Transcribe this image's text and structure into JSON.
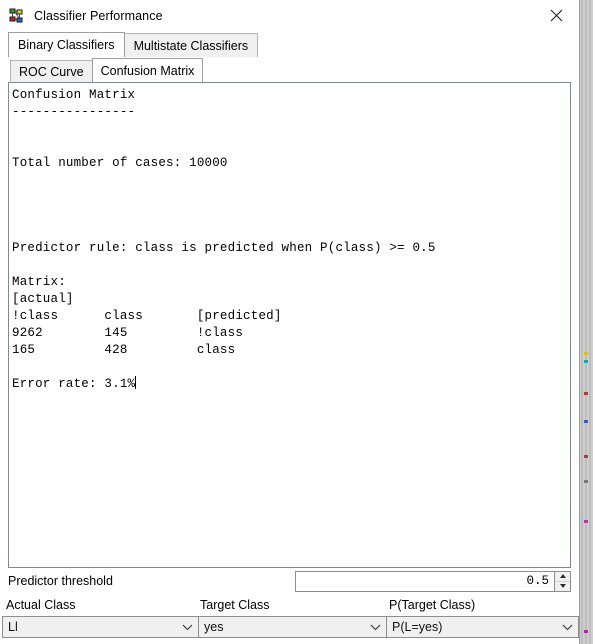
{
  "window": {
    "title": "Classifier Performance",
    "icon": "classifier-network-icon",
    "close_label": "×"
  },
  "outer_tabs": [
    {
      "label": "Binary Classifiers",
      "active": true
    },
    {
      "label": "Multistate Classifiers",
      "active": false
    }
  ],
  "inner_tabs": [
    {
      "label": "ROC Curve",
      "active": false
    },
    {
      "label": "Confusion Matrix",
      "active": true
    }
  ],
  "report": {
    "heading": "Confusion Matrix",
    "underline": "----------------",
    "total_cases_line": "Total number of cases: 10000",
    "predictor_rule_line": "Predictor rule: class is predicted when P(class) >= 0.5",
    "matrix_label": "Matrix:",
    "actual_label": "[actual]",
    "matrix_header": "!class      class       [predicted]",
    "matrix_row_1": "9262        145         !class",
    "matrix_row_2": "165         428         class",
    "error_rate_line": "Error rate: 3.1%",
    "full_text": "Confusion Matrix\n----------------\n\n\nTotal number of cases: 10000\n\n\n\n\nPredictor rule: class is predicted when P(class) >= 0.5\n\nMatrix:\n[actual]\n!class      class       [predicted]\n9262        145         !class\n165         428         class\n\nError rate: 3.1%"
  },
  "matrix_data": {
    "total_cases": 10000,
    "threshold": 0.5,
    "error_rate_percent": 3.1,
    "columns": [
      "!class",
      "class"
    ],
    "row_header": "[predicted]",
    "rows": [
      {
        "predicted": "!class",
        "counts": [
          9262,
          145
        ]
      },
      {
        "predicted": "class",
        "counts": [
          165,
          428
        ]
      }
    ]
  },
  "threshold": {
    "label": "Predictor threshold",
    "value": "0.5",
    "increment_icon": "spinner-up-icon",
    "decrement_icon": "spinner-down-icon"
  },
  "selectors": [
    {
      "name": "actual-class",
      "label": "Actual Class",
      "value": "Ll",
      "chevron_icon": "chevron-down-icon"
    },
    {
      "name": "target-class",
      "label": "Target Class",
      "value": "yes",
      "chevron_icon": "chevron-down-icon"
    },
    {
      "name": "p-target-class",
      "label": "P(Target Class)",
      "value": "P(L=yes)",
      "chevron_icon": "chevron-down-icon"
    }
  ],
  "colors": {
    "window_bg": "#ffffff",
    "tab_inactive": "#f0f0f0",
    "border": "#8d8d8d",
    "text": "#000000",
    "desktop": "#cfcfcf"
  }
}
